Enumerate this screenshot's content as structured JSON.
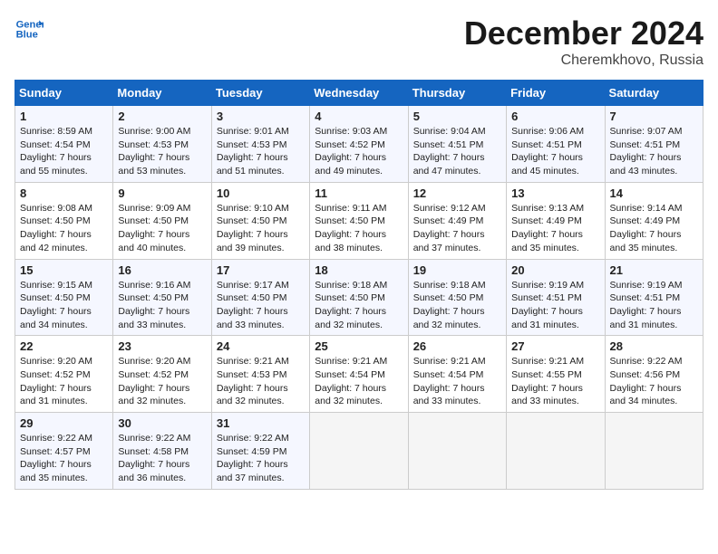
{
  "header": {
    "logo_line1": "General",
    "logo_line2": "Blue",
    "title": "December 2024",
    "subtitle": "Cheremkhovo, Russia"
  },
  "weekdays": [
    "Sunday",
    "Monday",
    "Tuesday",
    "Wednesday",
    "Thursday",
    "Friday",
    "Saturday"
  ],
  "weeks": [
    [
      {
        "day": "1",
        "sunrise": "Sunrise: 8:59 AM",
        "sunset": "Sunset: 4:54 PM",
        "daylight": "Daylight: 7 hours and 55 minutes."
      },
      {
        "day": "2",
        "sunrise": "Sunrise: 9:00 AM",
        "sunset": "Sunset: 4:53 PM",
        "daylight": "Daylight: 7 hours and 53 minutes."
      },
      {
        "day": "3",
        "sunrise": "Sunrise: 9:01 AM",
        "sunset": "Sunset: 4:53 PM",
        "daylight": "Daylight: 7 hours and 51 minutes."
      },
      {
        "day": "4",
        "sunrise": "Sunrise: 9:03 AM",
        "sunset": "Sunset: 4:52 PM",
        "daylight": "Daylight: 7 hours and 49 minutes."
      },
      {
        "day": "5",
        "sunrise": "Sunrise: 9:04 AM",
        "sunset": "Sunset: 4:51 PM",
        "daylight": "Daylight: 7 hours and 47 minutes."
      },
      {
        "day": "6",
        "sunrise": "Sunrise: 9:06 AM",
        "sunset": "Sunset: 4:51 PM",
        "daylight": "Daylight: 7 hours and 45 minutes."
      },
      {
        "day": "7",
        "sunrise": "Sunrise: 9:07 AM",
        "sunset": "Sunset: 4:51 PM",
        "daylight": "Daylight: 7 hours and 43 minutes."
      }
    ],
    [
      {
        "day": "8",
        "sunrise": "Sunrise: 9:08 AM",
        "sunset": "Sunset: 4:50 PM",
        "daylight": "Daylight: 7 hours and 42 minutes."
      },
      {
        "day": "9",
        "sunrise": "Sunrise: 9:09 AM",
        "sunset": "Sunset: 4:50 PM",
        "daylight": "Daylight: 7 hours and 40 minutes."
      },
      {
        "day": "10",
        "sunrise": "Sunrise: 9:10 AM",
        "sunset": "Sunset: 4:50 PM",
        "daylight": "Daylight: 7 hours and 39 minutes."
      },
      {
        "day": "11",
        "sunrise": "Sunrise: 9:11 AM",
        "sunset": "Sunset: 4:50 PM",
        "daylight": "Daylight: 7 hours and 38 minutes."
      },
      {
        "day": "12",
        "sunrise": "Sunrise: 9:12 AM",
        "sunset": "Sunset: 4:49 PM",
        "daylight": "Daylight: 7 hours and 37 minutes."
      },
      {
        "day": "13",
        "sunrise": "Sunrise: 9:13 AM",
        "sunset": "Sunset: 4:49 PM",
        "daylight": "Daylight: 7 hours and 35 minutes."
      },
      {
        "day": "14",
        "sunrise": "Sunrise: 9:14 AM",
        "sunset": "Sunset: 4:49 PM",
        "daylight": "Daylight: 7 hours and 35 minutes."
      }
    ],
    [
      {
        "day": "15",
        "sunrise": "Sunrise: 9:15 AM",
        "sunset": "Sunset: 4:50 PM",
        "daylight": "Daylight: 7 hours and 34 minutes."
      },
      {
        "day": "16",
        "sunrise": "Sunrise: 9:16 AM",
        "sunset": "Sunset: 4:50 PM",
        "daylight": "Daylight: 7 hours and 33 minutes."
      },
      {
        "day": "17",
        "sunrise": "Sunrise: 9:17 AM",
        "sunset": "Sunset: 4:50 PM",
        "daylight": "Daylight: 7 hours and 33 minutes."
      },
      {
        "day": "18",
        "sunrise": "Sunrise: 9:18 AM",
        "sunset": "Sunset: 4:50 PM",
        "daylight": "Daylight: 7 hours and 32 minutes."
      },
      {
        "day": "19",
        "sunrise": "Sunrise: 9:18 AM",
        "sunset": "Sunset: 4:50 PM",
        "daylight": "Daylight: 7 hours and 32 minutes."
      },
      {
        "day": "20",
        "sunrise": "Sunrise: 9:19 AM",
        "sunset": "Sunset: 4:51 PM",
        "daylight": "Daylight: 7 hours and 31 minutes."
      },
      {
        "day": "21",
        "sunrise": "Sunrise: 9:19 AM",
        "sunset": "Sunset: 4:51 PM",
        "daylight": "Daylight: 7 hours and 31 minutes."
      }
    ],
    [
      {
        "day": "22",
        "sunrise": "Sunrise: 9:20 AM",
        "sunset": "Sunset: 4:52 PM",
        "daylight": "Daylight: 7 hours and 31 minutes."
      },
      {
        "day": "23",
        "sunrise": "Sunrise: 9:20 AM",
        "sunset": "Sunset: 4:52 PM",
        "daylight": "Daylight: 7 hours and 32 minutes."
      },
      {
        "day": "24",
        "sunrise": "Sunrise: 9:21 AM",
        "sunset": "Sunset: 4:53 PM",
        "daylight": "Daylight: 7 hours and 32 minutes."
      },
      {
        "day": "25",
        "sunrise": "Sunrise: 9:21 AM",
        "sunset": "Sunset: 4:54 PM",
        "daylight": "Daylight: 7 hours and 32 minutes."
      },
      {
        "day": "26",
        "sunrise": "Sunrise: 9:21 AM",
        "sunset": "Sunset: 4:54 PM",
        "daylight": "Daylight: 7 hours and 33 minutes."
      },
      {
        "day": "27",
        "sunrise": "Sunrise: 9:21 AM",
        "sunset": "Sunset: 4:55 PM",
        "daylight": "Daylight: 7 hours and 33 minutes."
      },
      {
        "day": "28",
        "sunrise": "Sunrise: 9:22 AM",
        "sunset": "Sunset: 4:56 PM",
        "daylight": "Daylight: 7 hours and 34 minutes."
      }
    ],
    [
      {
        "day": "29",
        "sunrise": "Sunrise: 9:22 AM",
        "sunset": "Sunset: 4:57 PM",
        "daylight": "Daylight: 7 hours and 35 minutes."
      },
      {
        "day": "30",
        "sunrise": "Sunrise: 9:22 AM",
        "sunset": "Sunset: 4:58 PM",
        "daylight": "Daylight: 7 hours and 36 minutes."
      },
      {
        "day": "31",
        "sunrise": "Sunrise: 9:22 AM",
        "sunset": "Sunset: 4:59 PM",
        "daylight": "Daylight: 7 hours and 37 minutes."
      },
      null,
      null,
      null,
      null
    ]
  ]
}
